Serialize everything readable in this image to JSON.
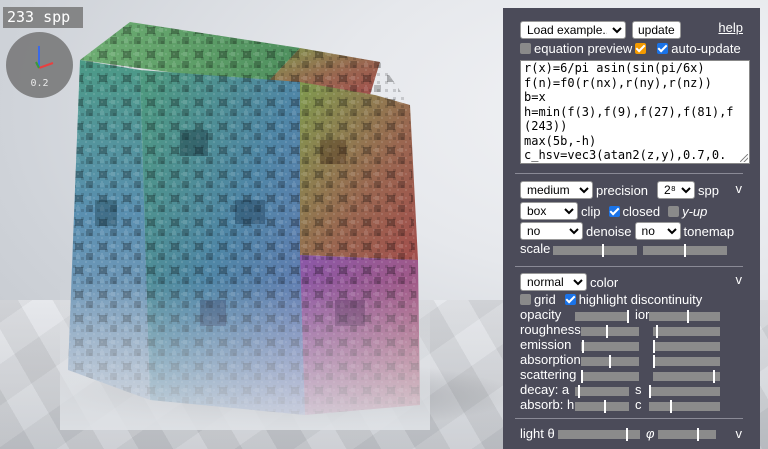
{
  "viewport": {
    "spp_counter": "233 spp",
    "axes_gizmo": {
      "scale_label": "0.2",
      "x_color": "#e84040",
      "y_color": "#3a9a3a",
      "z_color": "#3a6ae8"
    }
  },
  "panel": {
    "example_select": {
      "selected": "Load example..."
    },
    "update_button": "update",
    "help_link": "help",
    "equation_preview": {
      "label": "equation preview",
      "checked": true
    },
    "auto_update": {
      "label": "auto-update",
      "checked": true
    },
    "code_lines": [
      "r(x)=6/pi asin(sin(pi/6x)",
      "f(n)=f0(r(nx),r(ny),r(nz))",
      "b=x",
      "h=min(f(3),f(9),f(27),f(81),f",
      "(243))",
      "max(5b,-h)",
      "c_hsv=vec3(atan2(z,y),0.7,0."
    ],
    "render_section": {
      "quality_select": "medium",
      "precision_label": "precision",
      "spp_select": "2⁸",
      "spp_label": "spp",
      "collapse_icon": "v",
      "clip_select": "box",
      "clip_label": "clip",
      "closed": {
        "label": "closed",
        "checked": true
      },
      "y_up": {
        "label": "y-up",
        "checked": false
      },
      "denoise_select": "no",
      "denoise_label": "denoise",
      "tonemap_select": "no",
      "tonemap_label": "tonemap",
      "scale_label": "scale",
      "scale_values": [
        0.6,
        0.5
      ]
    },
    "material_section": {
      "color_mode_select": "normal",
      "color_label": "color",
      "collapse_icon": "v",
      "grid": {
        "label": "grid",
        "checked": false
      },
      "highlight_discontinuity": {
        "label": "highlight discontinuity",
        "checked": true
      },
      "sliders": [
        {
          "label": "opacity",
          "value": 1.0,
          "label2": "ior",
          "value2": 0.55
        },
        {
          "label": "roughness",
          "value": 0.45,
          "label2": "",
          "value2": 0.05
        },
        {
          "label": "emission",
          "value": 0.02,
          "label2": "",
          "value2": 0.0
        },
        {
          "label": "absorption",
          "value": 0.5,
          "label2": "",
          "value2": 0.0
        },
        {
          "label": "scattering",
          "value": 0.0,
          "label2": "",
          "value2": 0.92
        },
        {
          "label": "decay: a",
          "value": 0.05,
          "label2": "s",
          "value2": 0.0
        },
        {
          "label": "absorb: h",
          "value": 0.55,
          "label2": "c",
          "value2": 0.3
        }
      ]
    },
    "light_section": {
      "theta_label": "light θ",
      "theta_value": 0.85,
      "phi_label": "φ",
      "phi_value": 0.7,
      "collapse_icon": "v"
    }
  }
}
